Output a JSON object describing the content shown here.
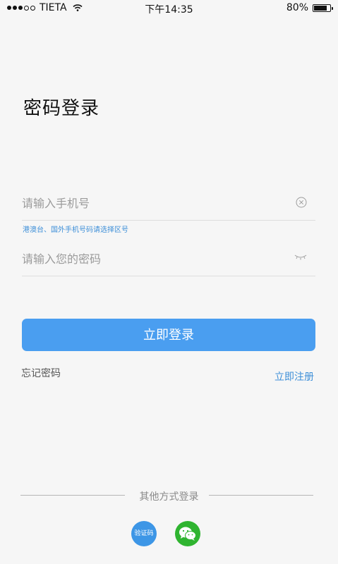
{
  "status_bar": {
    "carrier": "TIETA",
    "time": "下午14:35",
    "battery_percent": "80%",
    "battery_level": 0.8
  },
  "page": {
    "title": "密码登录"
  },
  "form": {
    "phone_placeholder": "请输入手机号",
    "region_hint": "港澳台、国外手机号码请选择区号",
    "password_placeholder": "请输入您的密码",
    "login_button": "立即登录",
    "forgot_password": "忘记密码",
    "register": "立即注册"
  },
  "other_login": {
    "label": "其他方式登录",
    "sms_label": "验证码",
    "wechat_icon": "wechat-icon"
  },
  "colors": {
    "accent": "#4a9ef0",
    "link": "#3d8fd8",
    "wechat": "#2fb430",
    "background": "#f6f6f6"
  }
}
